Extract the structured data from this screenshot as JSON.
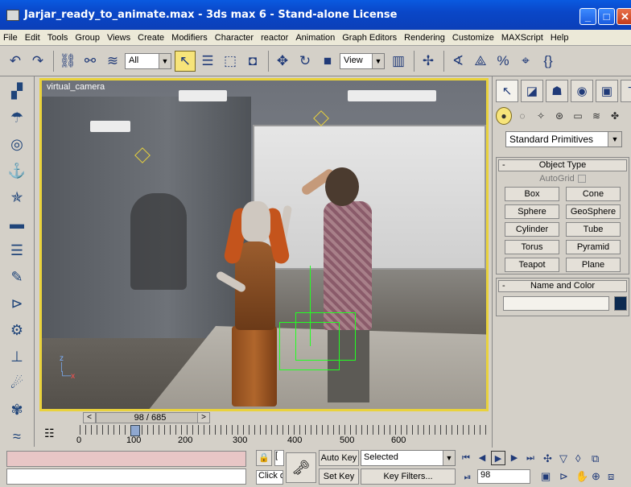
{
  "window": {
    "title": "Jarjar_ready_to_animate.max - 3ds max 6 - Stand-alone License"
  },
  "menu": [
    "File",
    "Edit",
    "Tools",
    "Group",
    "Views",
    "Create",
    "Modifiers",
    "Character",
    "reactor",
    "Animation",
    "Graph Editors",
    "Rendering",
    "Customize",
    "MAXScript",
    "Help"
  ],
  "toolbar": {
    "selection_filter": "All",
    "reference_coord": "View"
  },
  "viewport": {
    "label": "virtual_camera",
    "axis_z": "z",
    "axis_x": "x"
  },
  "time_slider": {
    "prev": "<",
    "next": ">",
    "frame_display": "98 / 685"
  },
  "ruler": {
    "labels": [
      "0",
      "100",
      "200",
      "300",
      "400",
      "500",
      "600"
    ]
  },
  "status": {
    "lock_icon": "lock-icon",
    "coord_value": "[",
    "prompt": "Click o",
    "auto_key": "Auto Key",
    "set_key": "Set Key",
    "key_mode": "Selected",
    "key_filters": "Key Filters...",
    "current_frame": "98"
  },
  "command_panel": {
    "category": "Standard Primitives",
    "object_type_title": "Object Type",
    "autogrid_label": "AutoGrid",
    "primitives": [
      "Box",
      "Cone",
      "Sphere",
      "GeoSphere",
      "Cylinder",
      "Tube",
      "Torus",
      "Pyramid",
      "Teapot",
      "Plane"
    ],
    "name_color_title": "Name and Color",
    "minus": "-",
    "object_color": "#0c2a50"
  },
  "colors": {
    "viewport_border": "#e9d23c",
    "title_bar": "#0a47c8",
    "helper_green": "#22ff22"
  }
}
